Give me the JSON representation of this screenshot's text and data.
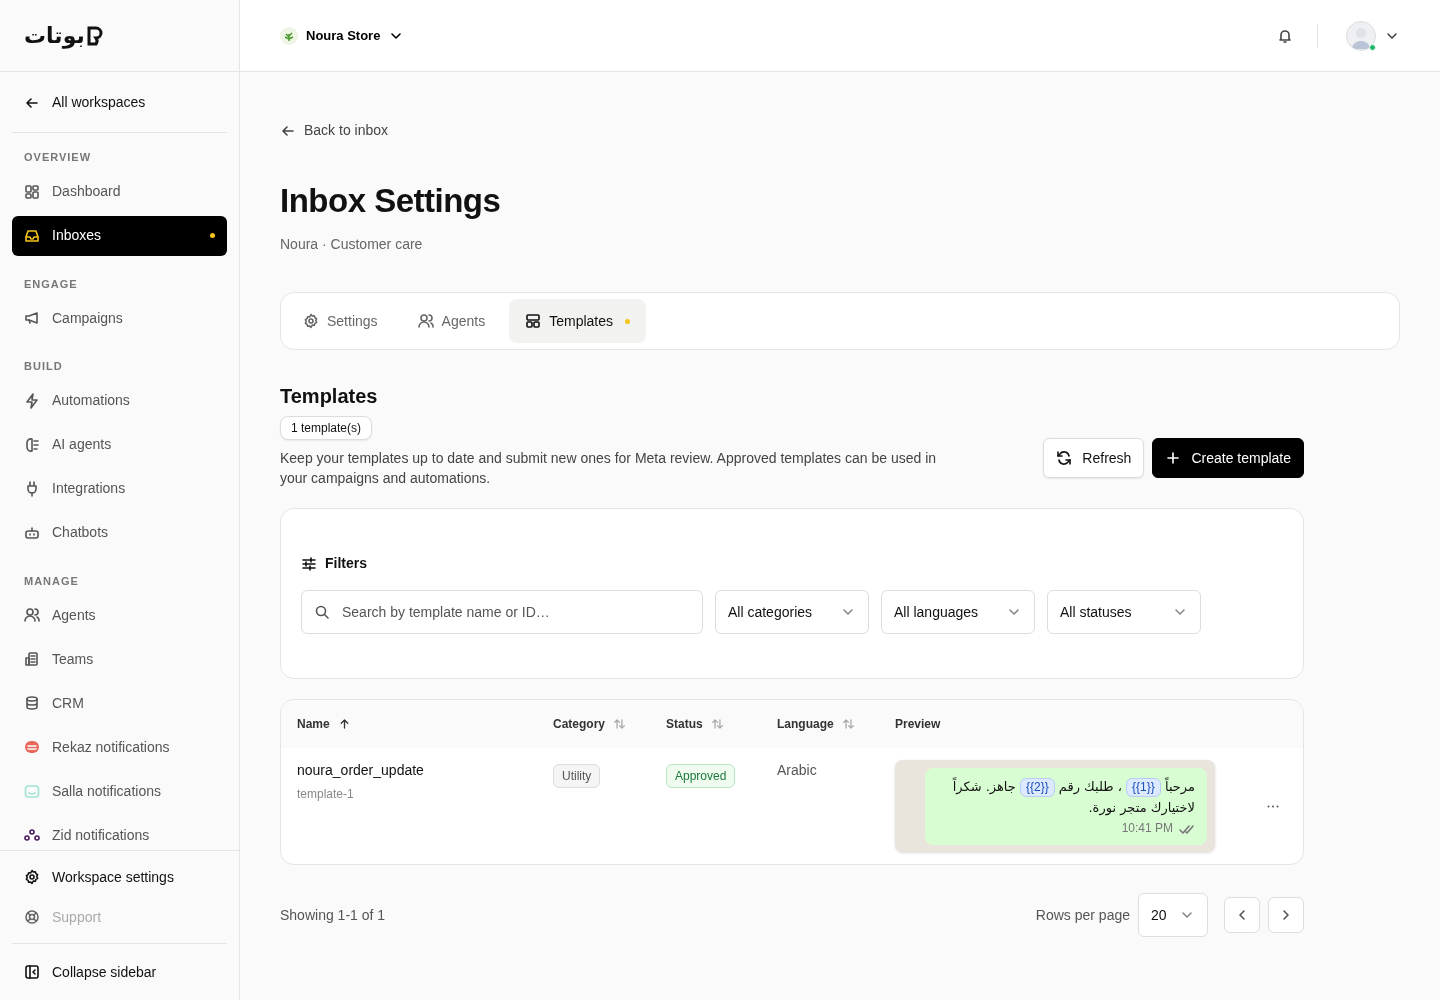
{
  "logo": {
    "text": "بوتات"
  },
  "topbar": {
    "store": "Noura Store",
    "user": {
      "online": true
    }
  },
  "sidebar": {
    "back": "All workspaces",
    "sections": [
      {
        "heading": "OVERVIEW",
        "items": [
          {
            "label": "Dashboard",
            "selected": false,
            "dot": false
          },
          {
            "label": "Inboxes",
            "selected": true,
            "dot": true
          }
        ]
      },
      {
        "heading": "ENGAGE",
        "items": [
          {
            "label": "Campaigns",
            "selected": false,
            "dot": false
          }
        ]
      },
      {
        "heading": "BUILD",
        "items": [
          {
            "label": "Automations",
            "selected": false,
            "dot": false
          },
          {
            "label": "AI agents",
            "selected": false,
            "dot": false
          },
          {
            "label": "Integrations",
            "selected": false,
            "dot": false
          },
          {
            "label": "Chatbots",
            "selected": false,
            "dot": false
          }
        ]
      },
      {
        "heading": "MANAGE",
        "items": [
          {
            "label": "Agents",
            "selected": false,
            "dot": false
          },
          {
            "label": "Teams",
            "selected": false,
            "dot": false
          },
          {
            "label": "CRM",
            "selected": false,
            "dot": false
          },
          {
            "label": "Rekaz notifications",
            "selected": false,
            "dot": false
          },
          {
            "label": "Salla notifications",
            "selected": false,
            "dot": false
          },
          {
            "label": "Zid notifications",
            "selected": false,
            "dot": false
          }
        ]
      }
    ],
    "footer": [
      {
        "label": "Workspace settings",
        "disabled": false
      },
      {
        "label": "Support",
        "disabled": true
      }
    ],
    "collapse": "Collapse sidebar"
  },
  "page": {
    "back": "Back to inbox",
    "title": "Inbox Settings",
    "subtitle": "Noura · Customer care"
  },
  "tabs": [
    {
      "label": "Settings",
      "selected": false,
      "dot": false
    },
    {
      "label": "Agents",
      "selected": false,
      "dot": false
    },
    {
      "label": "Templates",
      "selected": true,
      "dot": true
    }
  ],
  "section": {
    "title": "Templates",
    "count": "1 template(s)",
    "description": "Keep your templates up to date and submit new ones for Meta review. Approved templates can be used in your campaigns and automations.",
    "buttons": [
      {
        "label": "Refresh",
        "kind": "secondary"
      },
      {
        "label": "Create template",
        "kind": "primary"
      }
    ]
  },
  "filters": {
    "title": "Filters",
    "search": {
      "placeholder": "Search by template name or ID…"
    },
    "selects": [
      "All categories",
      "All languages",
      "All statuses"
    ]
  },
  "table": {
    "columns": [
      {
        "label": "Name",
        "sorted": true
      },
      {
        "label": "Category",
        "sorted": false
      },
      {
        "label": "Status",
        "sorted": false
      },
      {
        "label": "Language",
        "sorted": false
      },
      {
        "label": "Preview"
      }
    ],
    "rows": [
      {
        "name": "noura_order_update",
        "id": "template-1",
        "category": "Utility",
        "status": "Approved",
        "language": "Arabic",
        "preview": {
          "segments": [
            {
              "kind": "text",
              "text": "مرحباً "
            },
            {
              "kind": "variable",
              "text": "{{1}}"
            },
            {
              "kind": "text",
              "text": " ، طلبك رقم "
            },
            {
              "kind": "variable",
              "text": "{{2}}"
            },
            {
              "kind": "text",
              "text": " جاهز. شكراً لاختيارك متجر نورة."
            }
          ],
          "time": "10:41 PM"
        }
      }
    ]
  },
  "pagination": {
    "summary": "Showing 1-1 of 1",
    "rows_label": "Rows per page",
    "rows_value": "20"
  }
}
